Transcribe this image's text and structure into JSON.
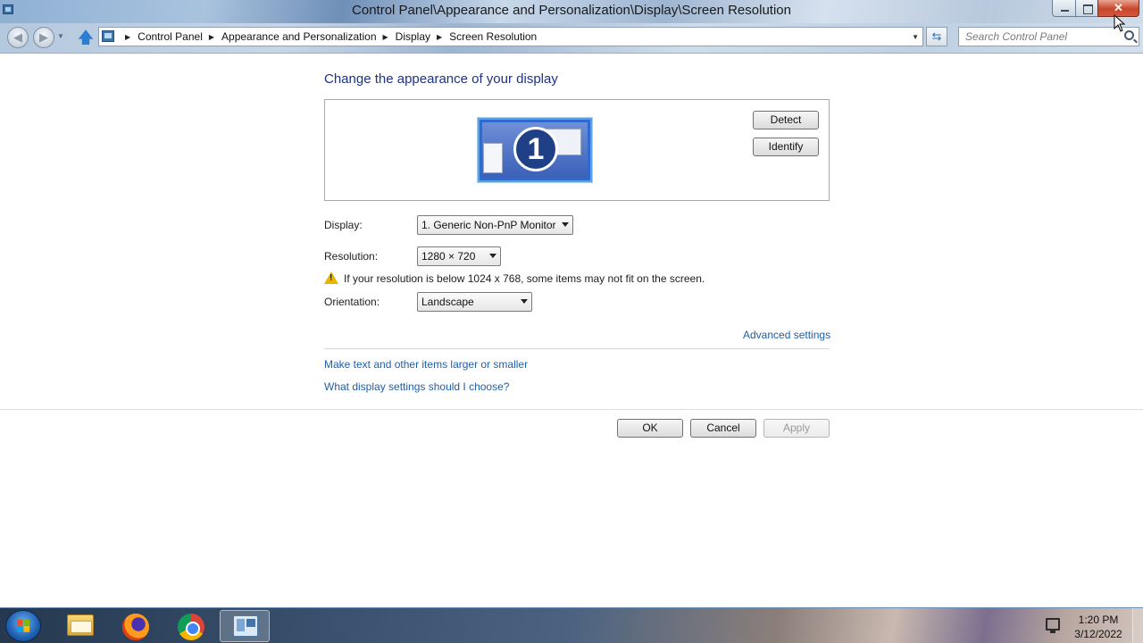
{
  "window": {
    "title": "Control Panel\\Appearance and Personalization\\Display\\Screen Resolution",
    "close_glyph": "✕"
  },
  "nav": {
    "breadcrumbs": [
      "Control Panel",
      "Appearance and Personalization",
      "Display",
      "Screen Resolution"
    ],
    "search_placeholder": "Search Control Panel"
  },
  "main": {
    "title": "Change the appearance of your display",
    "monitor_number": "1",
    "detect_label": "Detect",
    "identify_label": "Identify",
    "display_label": "Display:",
    "display_value": "1. Generic Non-PnP Monitor",
    "resolution_label": "Resolution:",
    "resolution_value": "1280 × 720",
    "warning_text": "If your resolution is below 1024 x 768, some items may not fit on the screen.",
    "orientation_label": "Orientation:",
    "orientation_value": "Landscape",
    "advanced_link": "Advanced settings",
    "text_size_link": "Make text and other items larger or smaller",
    "help_link": "What display settings should I choose?",
    "ok_label": "OK",
    "cancel_label": "Cancel",
    "apply_label": "Apply"
  },
  "taskbar": {
    "items": [
      "start",
      "windows-explorer",
      "firefox",
      "chrome",
      "control-panel"
    ],
    "time": "1:20 PM",
    "date": "3/12/2022"
  },
  "icons": {
    "app": "control-panel-icon",
    "warning": "warning-icon",
    "search": "search-icon"
  }
}
